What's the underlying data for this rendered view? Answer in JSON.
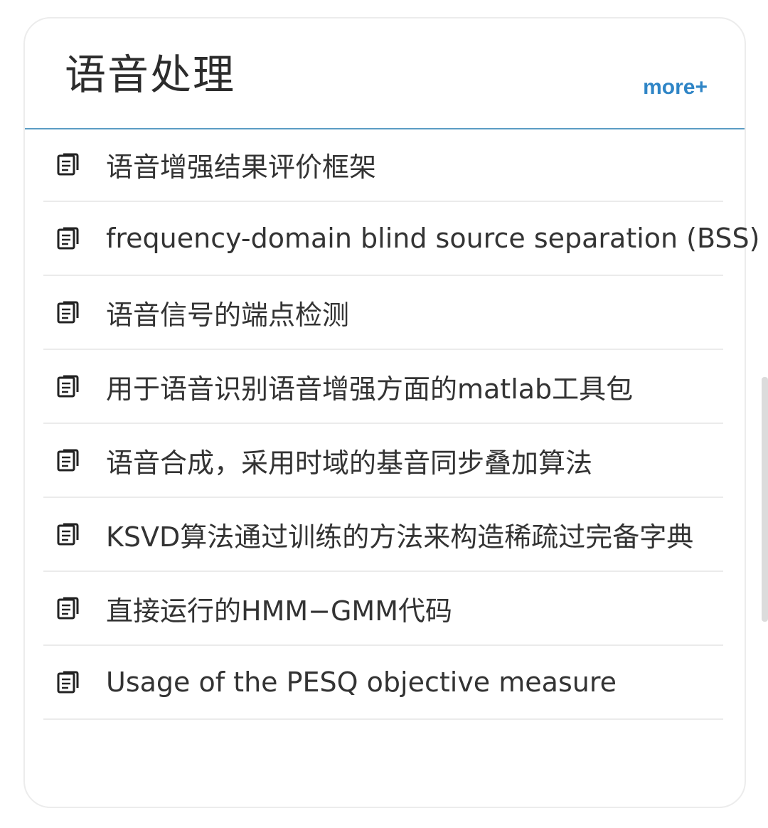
{
  "header": {
    "title": "语音处理",
    "more_label": "more+"
  },
  "colors": {
    "accent": "#2f85c6",
    "divider": "#5b9cc4",
    "text": "#333333"
  },
  "list": {
    "icon": "document-list-icon",
    "items": [
      {
        "label": "语音增强结果评价框架"
      },
      {
        "label": "frequency-domain blind source separation (BSS)"
      },
      {
        "label": "语音信号的端点检测"
      },
      {
        "label": "用于语音识别语音增强方面的matlab工具包"
      },
      {
        "label": "语音合成，采用时域的基音同步叠加算法"
      },
      {
        "label": "KSVD算法通过训练的方法来构造稀疏过完备字典"
      },
      {
        "label": "直接运行的HMM−GMM代码"
      },
      {
        "label": "Usage of the PESQ objective measure"
      }
    ]
  }
}
